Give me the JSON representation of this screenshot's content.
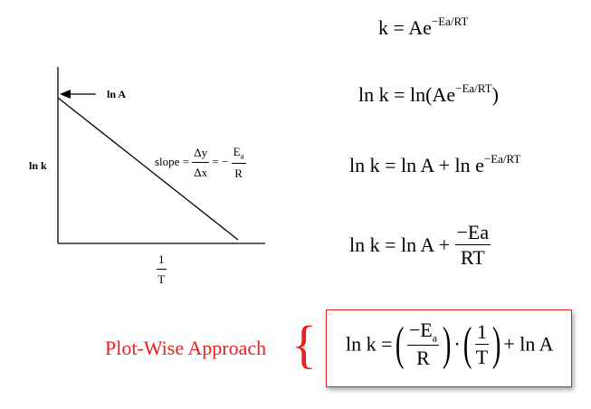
{
  "graph": {
    "y_label": "ln k",
    "intercept_label": "ln A",
    "x_label_num": "1",
    "x_label_den": "T",
    "slope_word": "slope =",
    "slope_dy": "Δy",
    "slope_dx": "Δx",
    "slope_eq_minus": "= −",
    "slope_Ea": "E",
    "slope_Ea_sub": "a",
    "slope_R": "R"
  },
  "equations": {
    "eq1_left": "k = Ae",
    "eq1_sup": "−Ea/RT",
    "eq2_left": "ln k = ln(Ae",
    "eq2_sup": "−Ea/RT",
    "eq2_close": ")",
    "eq3_left": "ln k = ln A + ln e",
    "eq3_sup": "−Ea/RT",
    "eq4_left": "ln k = ln A +",
    "eq4_num": "−Ea",
    "eq4_den": "RT",
    "final_left": "ln k =",
    "final_num1": "−E",
    "final_num1_sub": "a",
    "final_den1": "R",
    "final_dot": "·",
    "final_num2": "1",
    "final_den2": "T",
    "final_right": "+ ln A"
  },
  "annotation": {
    "label": "Plot-Wise Approach",
    "brace": "{",
    "color": "#e8201f"
  }
}
